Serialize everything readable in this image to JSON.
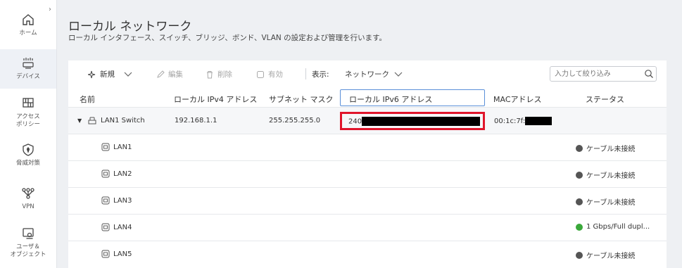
{
  "sidebar": {
    "items": [
      {
        "label": "ホーム",
        "icon": "home-icon"
      },
      {
        "label": "デバイス",
        "icon": "devices-icon"
      },
      {
        "label": "アクセス\nポリシー",
        "icon": "access-policy-icon"
      },
      {
        "label": "脅威対策",
        "icon": "shield-icon"
      },
      {
        "label": "VPN",
        "icon": "vpn-icon"
      },
      {
        "label": "ユーザ＆\nオブジェクト",
        "icon": "users-objects-icon"
      }
    ]
  },
  "header": {
    "title": "ローカル ネットワーク",
    "subtitle": "ローカル インタフェース、スイッチ、ブリッジ、ボンド、VLAN の設定および管理を行います。"
  },
  "toolbar": {
    "new_label": "新規",
    "edit_label": "編集",
    "delete_label": "削除",
    "enable_label": "有効",
    "view_label": "表示:",
    "view_value": "ネットワーク",
    "search_placeholder": "入力して絞り込み"
  },
  "table": {
    "headers": [
      "名前",
      "ローカル IPv4 アドレス",
      "サブネット マスク",
      "ローカル IPv6 アドレス",
      "MACアドレス",
      "ステータス"
    ],
    "group": {
      "name": "LAN1 Switch",
      "ipv4": "192.168.1.1",
      "mask": "255.255.255.0",
      "ipv6_prefix": "240",
      "mac_prefix": "00:1c:7f:"
    },
    "rows": [
      {
        "name": "LAN1",
        "status": "ケーブル未接続",
        "status_color": "#555555"
      },
      {
        "name": "LAN2",
        "status": "ケーブル未接続",
        "status_color": "#555555"
      },
      {
        "name": "LAN3",
        "status": "ケーブル未接続",
        "status_color": "#555555"
      },
      {
        "name": "LAN4",
        "status": "1 Gbps/Full dupl...",
        "status_color": "#3aa83a"
      },
      {
        "name": "LAN5",
        "status": "ケーブル未接続",
        "status_color": "#555555"
      }
    ]
  },
  "colors": {
    "accent": "#5a8fd8",
    "highlight": "#e0152b",
    "connected": "#3aa83a",
    "disconnected": "#555555"
  }
}
